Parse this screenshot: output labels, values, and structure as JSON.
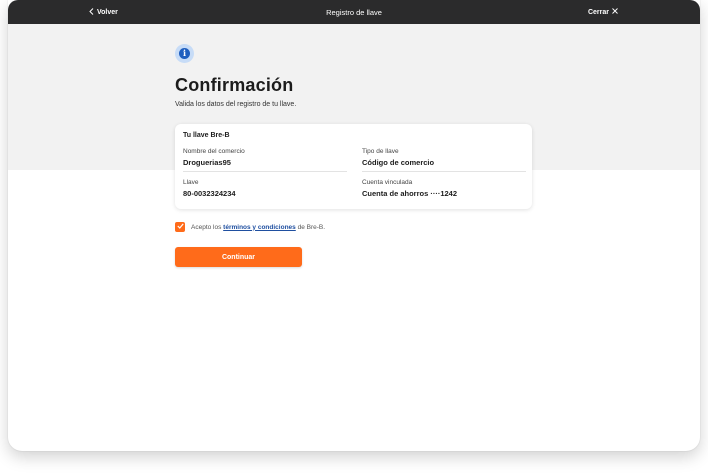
{
  "topbar": {
    "back_label": "Volver",
    "title": "Registro de llave",
    "close_label": "Cerrar"
  },
  "page": {
    "title": "Confirmación",
    "subtitle": "Valida los datos del registro de tu llave."
  },
  "card": {
    "title": "Tu llave Bre-B",
    "fields": [
      {
        "label": "Nombre del comercio",
        "value": "Droguerias95"
      },
      {
        "label": "Tipo de llave",
        "value": "Código de comercio"
      },
      {
        "label": "Llave",
        "value": "80-0032324234"
      },
      {
        "label": "Cuenta vinculada",
        "value": "Cuenta de ahorros ····1242"
      }
    ]
  },
  "terms": {
    "prefix": "Acepto los",
    "link": "términos y condiciones",
    "suffix": "de Bre-B.",
    "checked": true
  },
  "actions": {
    "continue_label": "Continuar"
  },
  "colors": {
    "accent": "#ff6b1a",
    "topbar": "#2b2b2c",
    "info": "#1f5fbf"
  },
  "icons": {
    "back": "chevron-left-icon",
    "close": "close-icon",
    "info": "info-icon",
    "check": "check-icon"
  }
}
